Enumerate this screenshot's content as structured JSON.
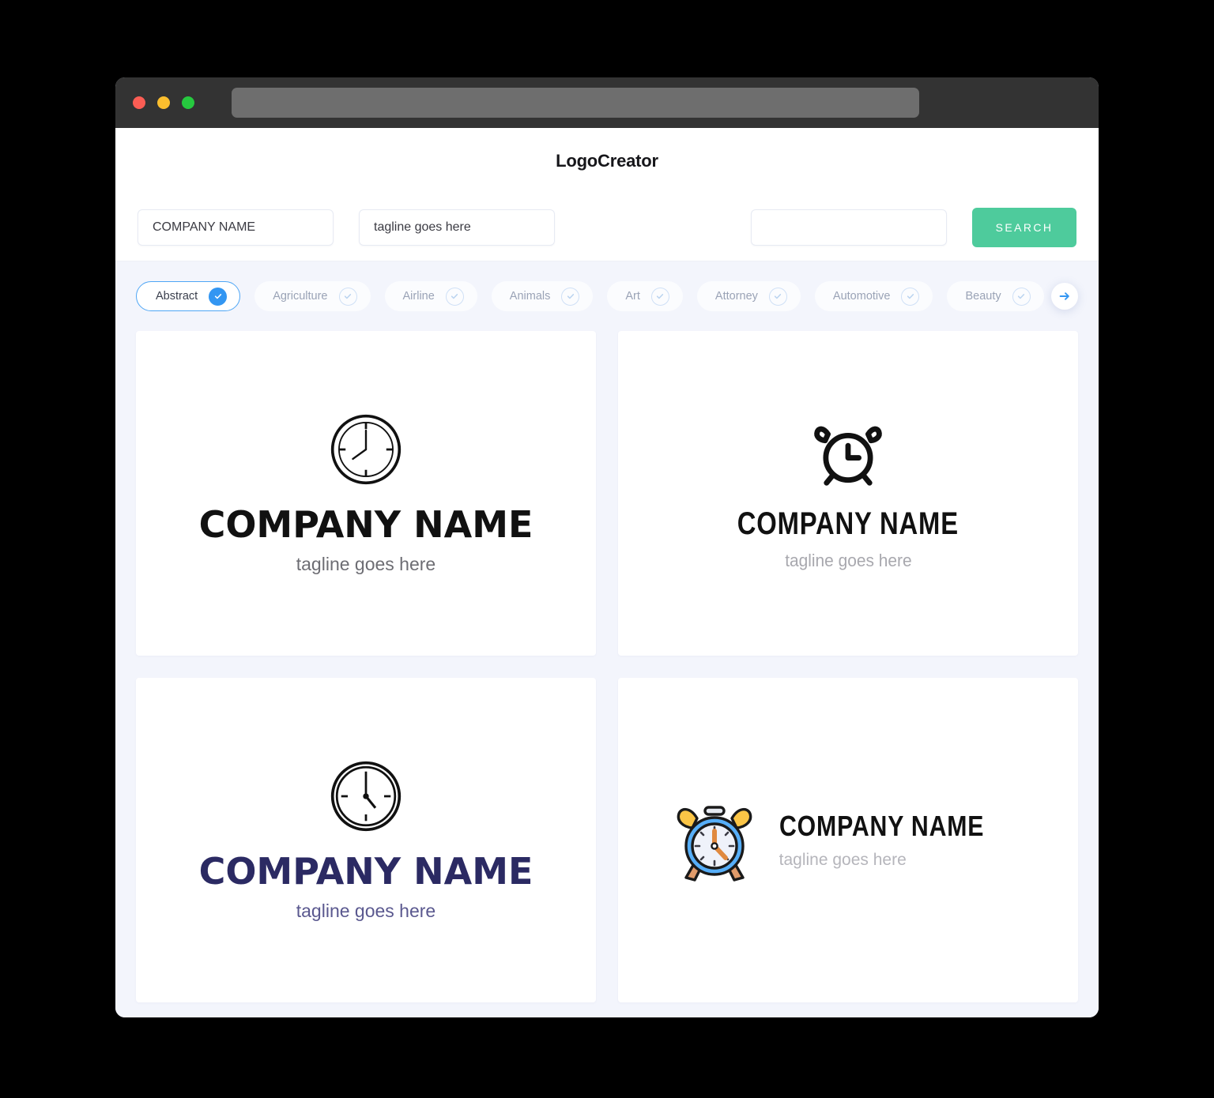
{
  "window": {
    "traffic_lights": [
      {
        "name": "close",
        "color": "#FB5D54"
      },
      {
        "name": "minimize",
        "color": "#FBBE2E"
      },
      {
        "name": "maximize",
        "color": "#26C93F"
      }
    ],
    "url_value": ""
  },
  "header": {
    "app_title": "LogoCreator"
  },
  "search": {
    "company_value": "COMPANY NAME",
    "company_placeholder": "COMPANY NAME",
    "tagline_value": "tagline goes here",
    "tagline_placeholder": "tagline goes here",
    "extra_value": "",
    "extra_placeholder": "",
    "search_label": "SEARCH",
    "search_color": "#4ECB9C"
  },
  "categories": {
    "scroll_next_icon": "arrow-right-icon",
    "accent_color": "#3396F2",
    "items": [
      {
        "label": "Abstract",
        "selected": true
      },
      {
        "label": "Agriculture",
        "selected": false
      },
      {
        "label": "Airline",
        "selected": false
      },
      {
        "label": "Animals",
        "selected": false
      },
      {
        "label": "Art",
        "selected": false
      },
      {
        "label": "Attorney",
        "selected": false
      },
      {
        "label": "Automotive",
        "selected": false
      },
      {
        "label": "Beauty",
        "selected": false
      }
    ]
  },
  "logos": [
    {
      "id": "logo-1",
      "icon": "clock-icon",
      "company": "COMPANY NAME",
      "tagline": "tagline goes here",
      "name_color": "#111111",
      "tagline_color": "#6D6D73",
      "layout": "stacked"
    },
    {
      "id": "logo-2",
      "icon": "alarm-clock-icon",
      "company": "COMPANY NAME",
      "tagline": "tagline goes here",
      "name_color": "#111111",
      "tagline_color": "#A8A8AE",
      "layout": "stacked"
    },
    {
      "id": "logo-3",
      "icon": "clock-icon",
      "company": "COMPANY NAME",
      "tagline": "tagline goes here",
      "name_color": "#2B2A63",
      "tagline_color": "#5A588F",
      "layout": "stacked"
    },
    {
      "id": "logo-4",
      "icon": "alarm-clock-color-icon",
      "company": "COMPANY NAME",
      "tagline": "tagline goes here",
      "name_color": "#111111",
      "tagline_color": "#B5B5BB",
      "layout": "horizontal"
    }
  ]
}
